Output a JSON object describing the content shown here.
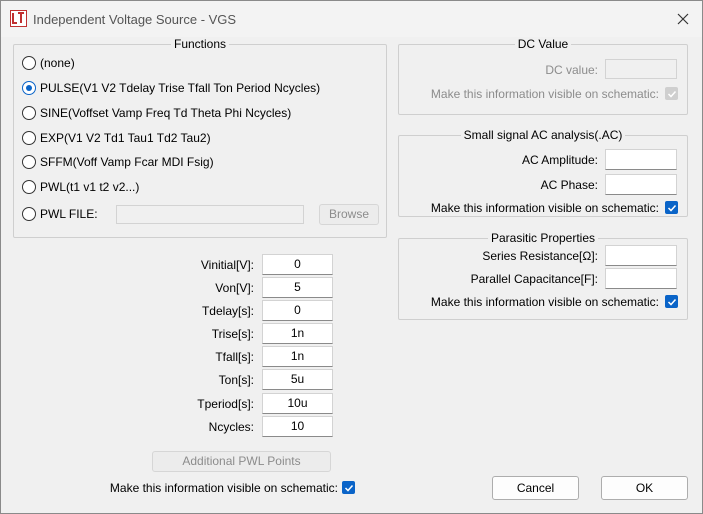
{
  "window": {
    "title": "Independent Voltage Source - VGS"
  },
  "functions": {
    "group_label": "Functions",
    "options": [
      {
        "label": "(none)",
        "checked": false
      },
      {
        "label": "PULSE(V1 V2 Tdelay Trise Tfall Ton Period Ncycles)",
        "checked": true
      },
      {
        "label": "SINE(Voffset Vamp Freq Td Theta Phi Ncycles)",
        "checked": false
      },
      {
        "label": "EXP(V1 V2 Td1 Tau1 Td2 Tau2)",
        "checked": false
      },
      {
        "label": "SFFM(Voff Vamp Fcar MDI Fsig)",
        "checked": false
      },
      {
        "label": "PWL(t1 v1 t2 v2...)",
        "checked": false
      },
      {
        "label": "PWL FILE:",
        "checked": false
      }
    ],
    "pwl_file_value": "",
    "browse_label": "Browse",
    "params": [
      {
        "label": "Vinitial[V]:",
        "value": "0"
      },
      {
        "label": "Von[V]:",
        "value": "5"
      },
      {
        "label": "Tdelay[s]:",
        "value": "0"
      },
      {
        "label": "Trise[s]:",
        "value": "1n"
      },
      {
        "label": "Tfall[s]:",
        "value": "1n"
      },
      {
        "label": "Ton[s]:",
        "value": "5u"
      },
      {
        "label": "Tperiod[s]:",
        "value": "10u"
      },
      {
        "label": "Ncycles:",
        "value": "10"
      }
    ],
    "additional_pwl_label": "Additional PWL Points",
    "visible_label": "Make this information visible on schematic:",
    "visible_checked": true
  },
  "dc_value": {
    "group_label": "DC Value",
    "dc_label": "DC value:",
    "dc_value": "",
    "visible_label": "Make this information visible on schematic:",
    "visible_checked": true
  },
  "ac_analysis": {
    "group_label": "Small signal AC analysis(.AC)",
    "amplitude_label": "AC Amplitude:",
    "amplitude_value": "",
    "phase_label": "AC Phase:",
    "phase_value": "",
    "visible_label": "Make this information visible on schematic:",
    "visible_checked": true
  },
  "parasitic": {
    "group_label": "Parasitic Properties",
    "series_label": "Series Resistance[Ω]:",
    "series_value": "",
    "parallel_label": "Parallel Capacitance[F]:",
    "parallel_value": "",
    "visible_label": "Make this information visible on schematic:",
    "visible_checked": true
  },
  "buttons": {
    "cancel": "Cancel",
    "ok": "OK"
  },
  "colors": {
    "accent": "#0a64c8",
    "disabled_text": "#8c8c8c"
  }
}
